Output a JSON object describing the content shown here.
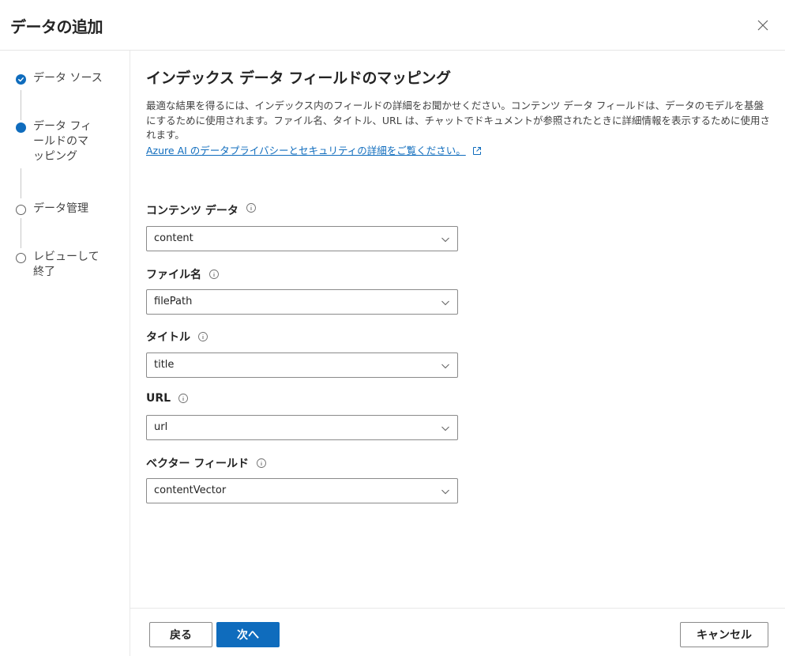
{
  "dialog": {
    "title": "データの追加"
  },
  "steps": [
    {
      "label": "データ ソース",
      "state": "done"
    },
    {
      "label": "データ フィールドのマッピング",
      "state": "current"
    },
    {
      "label": "データ管理",
      "state": "pending"
    },
    {
      "label": "レビューして終了",
      "state": "pending"
    }
  ],
  "main": {
    "title": "インデックス データ フィールドのマッピング",
    "description": "最適な結果を得るには、インデックス内のフィールドの詳細をお聞かせください。コンテンツ データ フィールドは、データのモデルを基盤にするために使用されます。ファイル名、タイトル、URL は、チャットでドキュメントが参照されたときに詳細情報を表示するために使用されます。",
    "privacy_link": "Azure AI のデータプライバシーとセキュリティの詳細をご覧ください。"
  },
  "fields": [
    {
      "label": "コンテンツ データ",
      "value": "content"
    },
    {
      "label": "ファイル名",
      "value": "filePath"
    },
    {
      "label": "タイトル",
      "value": "title"
    },
    {
      "label": "URL",
      "value": "url"
    },
    {
      "label": "ベクター フィールド",
      "value": "contentVector"
    }
  ],
  "footer": {
    "back_label": "戻る",
    "next_label": "次へ",
    "cancel_label": "キャンセル"
  },
  "colors": {
    "accent": "#0f6cbd"
  },
  "icons": [
    "close-icon",
    "checkmark-icon",
    "info-icon",
    "chevron-down-icon",
    "external-link-icon"
  ]
}
